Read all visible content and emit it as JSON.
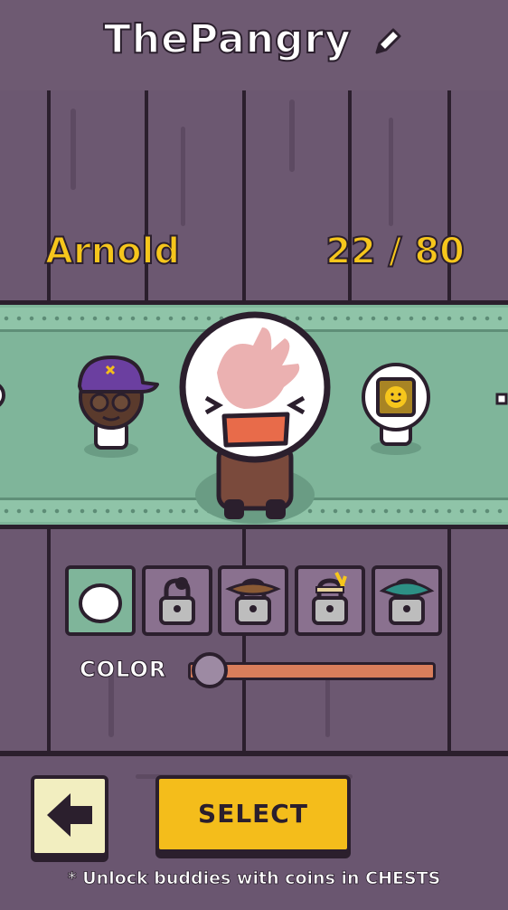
{
  "header": {
    "player_name": "ThePangry",
    "edit_icon": "pencil-icon"
  },
  "character": {
    "name": "Arnold",
    "count": "22 / 80"
  },
  "carousel": {
    "items": [
      {
        "id": "left-buddy",
        "icon": "cap-glasses-buddy"
      },
      {
        "id": "center-buddy",
        "icon": "slap-face-buddy",
        "selected": true
      },
      {
        "id": "right-buddy",
        "icon": "tv-head-buddy"
      }
    ]
  },
  "skins": [
    {
      "icon": "plain-white-head-icon",
      "locked": false,
      "selected": true
    },
    {
      "icon": "lock-icon",
      "locked": true,
      "accessory": "black-bun"
    },
    {
      "icon": "lock-icon",
      "locked": true,
      "accessory": "brown-cowboy-hat"
    },
    {
      "icon": "lock-icon",
      "locked": true,
      "accessory": "feather-headband"
    },
    {
      "icon": "lock-icon",
      "locked": true,
      "accessory": "teal-hat"
    }
  ],
  "color": {
    "label": "COLOR",
    "value": 0
  },
  "buttons": {
    "back_icon": "arrow-left-icon",
    "select_label": "SELECT"
  },
  "footer": {
    "hint": "* Unlock buddies with coins in CHESTS"
  },
  "colors": {
    "accent": "#f4bd1b",
    "band": "#7fb59a",
    "wood": "#6e5a72",
    "outline": "#2b1f2d"
  }
}
